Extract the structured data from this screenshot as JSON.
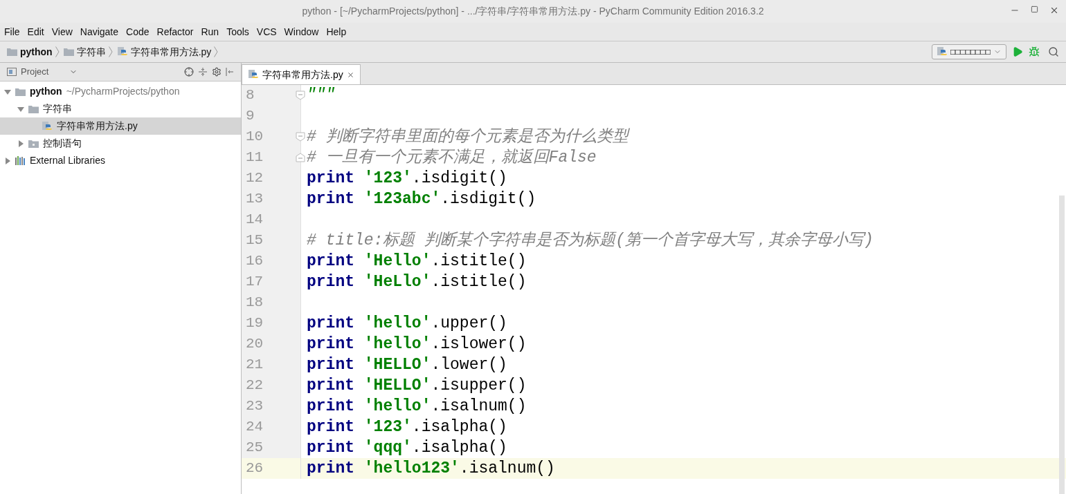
{
  "window": {
    "title": "python - [~/PycharmProjects/python] - .../字符串/字符串常用方法.py - PyCharm Community Edition 2016.3.2"
  },
  "menu": [
    {
      "label": "File"
    },
    {
      "label": "Edit"
    },
    {
      "label": "View"
    },
    {
      "label": "Navigate"
    },
    {
      "label": "Code"
    },
    {
      "label": "Refactor"
    },
    {
      "label": "Run"
    },
    {
      "label": "Tools"
    },
    {
      "label": "VCS"
    },
    {
      "label": "Window"
    },
    {
      "label": "Help"
    }
  ],
  "breadcrumbs": [
    {
      "label": "python",
      "kind": "folder",
      "bold": true
    },
    {
      "label": "字符串",
      "kind": "folder",
      "bold": false
    },
    {
      "label": "字符串常用方法.py",
      "kind": "python",
      "bold": false
    }
  ],
  "run_config": {
    "label": "□□□□□□□□"
  },
  "project_panel": {
    "title": "Project",
    "tree": [
      {
        "label": "python",
        "hint": "~/PycharmProjects/python",
        "kind": "folder",
        "expanded": true,
        "selected": false,
        "children": [
          {
            "label": "字符串",
            "kind": "folder",
            "expanded": true,
            "selected": false,
            "children": [
              {
                "label": "字符串常用方法.py",
                "kind": "python",
                "selected": true
              }
            ]
          },
          {
            "label": "控制语句",
            "kind": "package",
            "expanded": false,
            "selected": false
          }
        ]
      },
      {
        "label": "External Libraries",
        "kind": "library",
        "expanded": false,
        "selected": false
      }
    ]
  },
  "editor_tabs": [
    {
      "label": "字符串常用方法.py",
      "selected": true
    }
  ],
  "code": [
    {
      "number": "8",
      "current": false,
      "fold_start": true,
      "tokens": [
        {
          "kind": "docstring",
          "text": "\"\"\""
        }
      ]
    },
    {
      "number": "9",
      "current": false
    },
    {
      "number": "10",
      "current": false,
      "fold_start": true,
      "tokens": [
        {
          "kind": "comment",
          "text": "# 判断字符串里面的每个元素是否为什么类型"
        }
      ]
    },
    {
      "number": "11",
      "current": false,
      "fold_end": true,
      "tokens": [
        {
          "kind": "comment",
          "text": "# 一旦有一个元素不满足，就返回False"
        }
      ]
    },
    {
      "number": "12",
      "current": false,
      "tokens": [
        {
          "kind": "keyword",
          "text": "print"
        },
        {
          "kind": "string",
          "text": "'123'"
        },
        {
          "kind": "plain",
          "text": ".isdigit()"
        }
      ]
    },
    {
      "number": "13",
      "current": false,
      "tokens": [
        {
          "kind": "keyword",
          "text": "print"
        },
        {
          "kind": "string",
          "text": "'123abc'"
        },
        {
          "kind": "plain",
          "text": ".isdigit()"
        }
      ]
    },
    {
      "number": "14",
      "current": false
    },
    {
      "number": "15",
      "current": false,
      "tokens": [
        {
          "kind": "comment",
          "text": "# title:标题 判断某个字符串是否为标题(第一个首字母大写，其余字母小写)"
        }
      ]
    },
    {
      "number": "16",
      "current": false,
      "tokens": [
        {
          "kind": "keyword",
          "text": "print"
        },
        {
          "kind": "string",
          "text": "'Hello'"
        },
        {
          "kind": "plain",
          "text": ".istitle()"
        }
      ]
    },
    {
      "number": "17",
      "current": false,
      "tokens": [
        {
          "kind": "keyword",
          "text": "print"
        },
        {
          "kind": "string",
          "text": "'HeLlo'"
        },
        {
          "kind": "plain",
          "text": ".istitle()"
        }
      ]
    },
    {
      "number": "18",
      "current": false
    },
    {
      "number": "19",
      "current": false,
      "tokens": [
        {
          "kind": "keyword",
          "text": "print"
        },
        {
          "kind": "string",
          "text": "'hello'"
        },
        {
          "kind": "plain",
          "text": ".upper()"
        }
      ]
    },
    {
      "number": "20",
      "current": false,
      "tokens": [
        {
          "kind": "keyword",
          "text": "print"
        },
        {
          "kind": "string",
          "text": "'hello'"
        },
        {
          "kind": "plain",
          "text": ".islower()"
        }
      ]
    },
    {
      "number": "21",
      "current": false,
      "tokens": [
        {
          "kind": "keyword",
          "text": "print"
        },
        {
          "kind": "string",
          "text": "'HELLO'"
        },
        {
          "kind": "plain",
          "text": ".lower()"
        }
      ]
    },
    {
      "number": "22",
      "current": false,
      "tokens": [
        {
          "kind": "keyword",
          "text": "print"
        },
        {
          "kind": "string",
          "text": "'HELLO'"
        },
        {
          "kind": "plain",
          "text": ".isupper()"
        }
      ]
    },
    {
      "number": "23",
      "current": false,
      "tokens": [
        {
          "kind": "keyword",
          "text": "print"
        },
        {
          "kind": "string",
          "text": "'hello'"
        },
        {
          "kind": "plain",
          "text": ".isalnum()"
        }
      ]
    },
    {
      "number": "24",
      "current": false,
      "tokens": [
        {
          "kind": "keyword",
          "text": "print"
        },
        {
          "kind": "string",
          "text": "'123'"
        },
        {
          "kind": "plain",
          "text": ".isalpha()"
        }
      ]
    },
    {
      "number": "25",
      "current": false,
      "tokens": [
        {
          "kind": "keyword",
          "text": "print"
        },
        {
          "kind": "string",
          "text": "'qqq'"
        },
        {
          "kind": "plain",
          "text": ".isalpha()"
        }
      ]
    },
    {
      "number": "26",
      "current": true,
      "tokens": [
        {
          "kind": "keyword",
          "text": "print"
        },
        {
          "kind": "string",
          "text": "'hello123'"
        },
        {
          "kind": "plain",
          "text": ".isalnum()"
        }
      ]
    }
  ]
}
